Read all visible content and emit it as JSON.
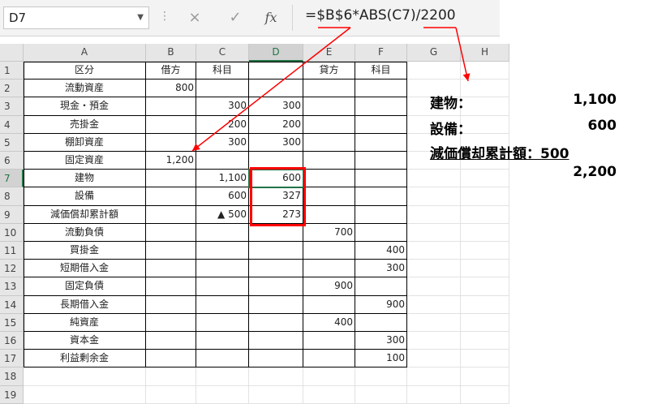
{
  "formula_bar": {
    "name_box": "D7",
    "cancel_icon": "×",
    "enter_icon": "✓",
    "fx_label": "fx",
    "formula": "=$B$6*ABS(C7)/2200"
  },
  "columns": [
    "A",
    "B",
    "C",
    "D",
    "E",
    "F",
    "G",
    "H"
  ],
  "selected_cell": "D7",
  "rows": [
    {
      "n": "1",
      "A": "区分",
      "B": "借方",
      "C": "科目",
      "D": "",
      "E": "貸方",
      "F": "科目"
    },
    {
      "n": "2",
      "A": "流動資産",
      "B": "800",
      "C": "",
      "D": "",
      "E": "",
      "F": ""
    },
    {
      "n": "3",
      "A": "現金・預金",
      "B": "",
      "C": "300",
      "D": "300",
      "E": "",
      "F": ""
    },
    {
      "n": "4",
      "A": "売掛金",
      "B": "",
      "C": "200",
      "D": "200",
      "E": "",
      "F": ""
    },
    {
      "n": "5",
      "A": "棚卸資産",
      "B": "",
      "C": "300",
      "D": "300",
      "E": "",
      "F": ""
    },
    {
      "n": "6",
      "A": "固定資産",
      "B": "1,200",
      "C": "",
      "D": "",
      "E": "",
      "F": ""
    },
    {
      "n": "7",
      "A": "建物",
      "B": "",
      "C": "1,100",
      "D": "600",
      "E": "",
      "F": ""
    },
    {
      "n": "8",
      "A": "設備",
      "B": "",
      "C": "600",
      "D": "327",
      "E": "",
      "F": ""
    },
    {
      "n": "9",
      "A": "減価償却累計額",
      "B": "",
      "C": "▲ 500",
      "D": "273",
      "E": "",
      "F": ""
    },
    {
      "n": "10",
      "A": "流動負債",
      "B": "",
      "C": "",
      "D": "",
      "E": "700",
      "F": ""
    },
    {
      "n": "11",
      "A": "買掛金",
      "B": "",
      "C": "",
      "D": "",
      "E": "",
      "F": "400"
    },
    {
      "n": "12",
      "A": "短期借入金",
      "B": "",
      "C": "",
      "D": "",
      "E": "",
      "F": "300"
    },
    {
      "n": "13",
      "A": "固定負債",
      "B": "",
      "C": "",
      "D": "",
      "E": "900",
      "F": ""
    },
    {
      "n": "14",
      "A": "長期借入金",
      "B": "",
      "C": "",
      "D": "",
      "E": "",
      "F": "900"
    },
    {
      "n": "15",
      "A": "純資産",
      "B": "",
      "C": "",
      "D": "",
      "E": "400",
      "F": ""
    },
    {
      "n": "16",
      "A": "資本金",
      "B": "",
      "C": "",
      "D": "",
      "E": "",
      "F": "300"
    },
    {
      "n": "17",
      "A": "利益剰余金",
      "B": "",
      "C": "",
      "D": "",
      "E": "",
      "F": "100"
    },
    {
      "n": "18",
      "A": "",
      "B": "",
      "C": "",
      "D": "",
      "E": "",
      "F": ""
    },
    {
      "n": "19",
      "A": "",
      "B": "",
      "C": "",
      "D": "",
      "E": "",
      "F": ""
    }
  ],
  "annotation": {
    "items": [
      {
        "label": "建物：",
        "value": "1,100"
      },
      {
        "label": "設備：",
        "value": "600"
      },
      {
        "label": "減価償却累計額：500",
        "value": ""
      }
    ],
    "total": "2,200",
    "arrow_color": "#ff0000"
  }
}
